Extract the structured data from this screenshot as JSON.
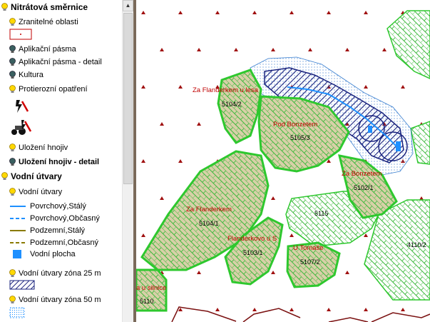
{
  "legend": {
    "nitratova_header": "Nitrátová směrnice",
    "zranitelne_oblasti": "Zranitelné oblasti",
    "aplikacni_pasma": "Aplikační pásma",
    "aplikacni_pasma_detail": "Aplikační pásma - detail",
    "kultura": "Kultura",
    "protierozni_opatreni": "Protierozní opatření",
    "ulozeni_hnojiv": "Uložení hnojiv",
    "ulozeni_hnojiv_detail": "Uložení hnojiv - detail",
    "vodni_utvary_header": "Vodní útvary",
    "vodni_utvary": "Vodní útvary",
    "povrchovy_staly": "Povrchový,Stálý",
    "povrchovy_obcasny": "Povrchový,Občasný",
    "podzemni_staly": "Podzemní,Stálý",
    "podzemni_obcasny": "Podzemní,Občasný",
    "vodni_plocha": "Vodní plocha",
    "zona25": "Vodní útvary zóna 25 m",
    "zona50": "Vodní útvary zóna 50 m"
  },
  "map": {
    "labels": {
      "za_flanderkem_u_lesa": "Za Flanderkem u lesa",
      "pod_bonzetem": "Pod Bonzetem",
      "za_bonzetem": "Za Bonzetem",
      "za_flanderkem": "Za Flanderkem",
      "flanderkovo_u_s": "Flanderkovo u S",
      "u_tomase": "U Tomaše",
      "u_silnice": "a u silnice",
      "p5104_2": "5104/2",
      "p5105_3": "5105/3",
      "p5102_1": "5102/1",
      "p5115": "5115",
      "p5104_1": "5104/1",
      "p5103_1": "5103/1",
      "p5107_2": "5107/2",
      "p4110_2": "4110/2",
      "p5110": "5110"
    }
  },
  "colors": {
    "parcel_green": "#2ec82e",
    "parcel_fill": "#d8d0a8",
    "water_blue": "#1e90ff",
    "zone25": "#1a237e",
    "label_red": "#c00000",
    "bulb_yellow": "#ffd800",
    "bulb_dark": "#3a6060"
  }
}
